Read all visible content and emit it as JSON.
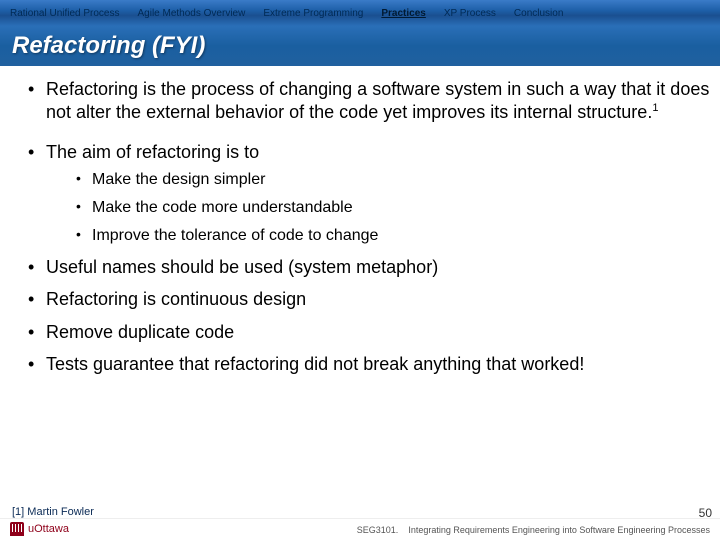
{
  "nav": {
    "items": [
      "Rational Unified Process",
      "Agile Methods Overview",
      "Extreme Programming",
      "Practices",
      "XP Process",
      "Conclusion"
    ],
    "activeIndex": 3
  },
  "title": "Refactoring (FYI)",
  "bullets": {
    "b1_pre": "Refactoring is the process of changing a software system in such a way that it does not alter the external behavior of the code yet improves its internal structure.",
    "b1_sup": "1",
    "b2": "The aim of refactoring is to",
    "b2_sub": [
      "Make the design simpler",
      "Make the code more understandable",
      "Improve the tolerance of code to change"
    ],
    "b3": "Useful names should be used (system metaphor)",
    "b4": "Refactoring is continuous design",
    "b5": "Remove duplicate code",
    "b6": "Tests guarantee that refactoring did not break anything that worked!"
  },
  "citation": "[1] Martin Fowler",
  "footer": {
    "course": "SEG3101.",
    "subtitle": "Integrating Requirements Engineering into Software Engineering Processes"
  },
  "logo_text": "uOttawa",
  "page": "50"
}
